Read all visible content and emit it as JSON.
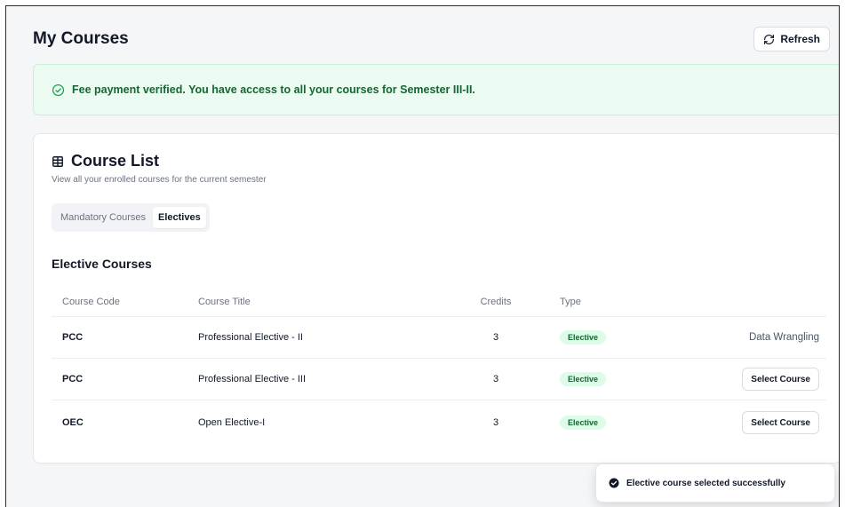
{
  "header": {
    "title": "My Courses",
    "refresh_label": "Refresh"
  },
  "alert": {
    "message": "Fee payment verified. You have access to all your courses for Semester III-II.",
    "icon": "check-circle-icon",
    "color": "#166534"
  },
  "card": {
    "title": "Course List",
    "subtitle": "View all your enrolled courses for the current semester",
    "tabs": [
      {
        "label": "Mandatory Courses",
        "active": false
      },
      {
        "label": "Electives",
        "active": true
      }
    ],
    "section_title": "Elective Courses",
    "columns": [
      "Course Code",
      "Course Title",
      "Credits",
      "Type"
    ],
    "rows": [
      {
        "code": "PCC",
        "title": "Professional Elective - II",
        "credits": "3",
        "type": "Elective",
        "action": "Data Wrangling"
      },
      {
        "code": "PCC",
        "title": "Professional Elective - III",
        "credits": "3",
        "type": "Elective",
        "action": "Select Course"
      },
      {
        "code": "OEC",
        "title": "Open Elective-I",
        "credits": "3",
        "type": "Elective",
        "action": "Select Course"
      }
    ]
  },
  "toast": {
    "message": "Elective course selected successfully",
    "icon": "check-circle-filled-icon"
  }
}
